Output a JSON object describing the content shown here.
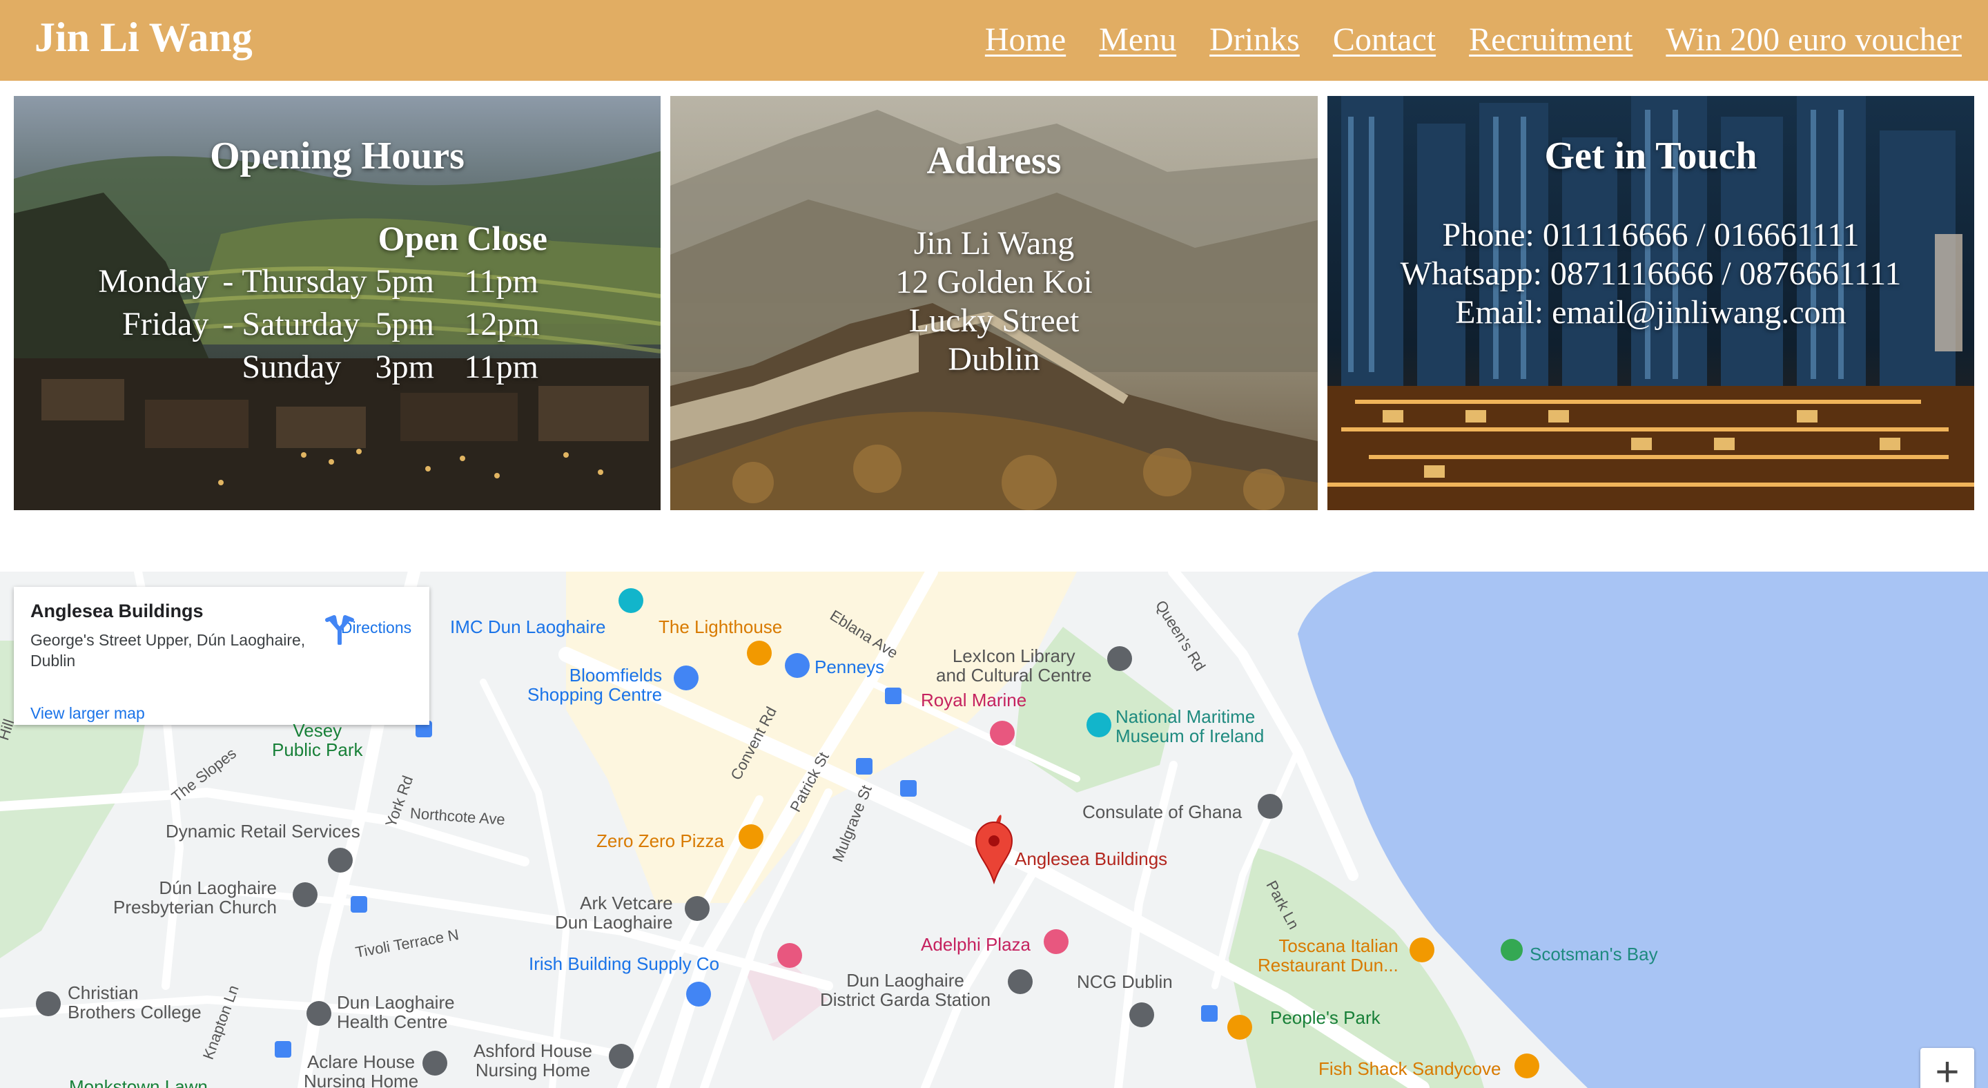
{
  "header": {
    "brand": "Jin Li Wang",
    "nav": [
      "Home",
      "Menu",
      "Drinks",
      "Contact",
      "Recruitment",
      "Win 200 euro voucher"
    ]
  },
  "hours": {
    "title": "Opening Hours",
    "col_open": "Open",
    "col_close": "Close",
    "rows": [
      {
        "from": "Monday",
        "dash": "-",
        "to": "Thursday",
        "open": "5pm",
        "close": "11pm"
      },
      {
        "from": "Friday",
        "dash": "-",
        "to": "Saturday",
        "open": "5pm",
        "close": "12pm"
      },
      {
        "from": "",
        "dash": "",
        "to": "Sunday",
        "open": "3pm",
        "close": "11pm"
      }
    ]
  },
  "address": {
    "title": "Address",
    "lines": [
      "Jin Li Wang",
      "12 Golden Koi",
      "Lucky Street",
      "Dublin"
    ]
  },
  "contact": {
    "title": "Get in Touch",
    "lines": [
      "Phone: 011116666 / 016661111",
      "Whatsapp: 0871116666 / 0876661111",
      "Email: email@jinliwang.com"
    ]
  },
  "map": {
    "card": {
      "title": "Anglesea Buildings",
      "address": "George's Street Upper, Dún Laoghaire, Dublin",
      "larger": "View larger map",
      "directions": "Directions"
    },
    "pois": {
      "imc": "IMC Dun Laoghaire",
      "lighthouse": "The Lighthouse",
      "penneys": "Penneys",
      "bloomfields": "Bloomfields\nShopping Centre",
      "lexicon": "LexIcon Library\nand Cultural Centre",
      "royal_marine": "Royal Marine",
      "maritime": "National Maritime\nMuseum of Ireland",
      "vesey": "Vesey\nPublic Park",
      "consulate": "Consulate of Ghana",
      "dynamic": "Dynamic Retail Services",
      "zero": "Zero Zero Pizza",
      "anglesea": "Anglesea Buildings",
      "presbyterian": "Dún Laoghaire\nPresbyterian Church",
      "ark": "Ark Vetcare\nDun Laoghaire",
      "adelphi": "Adelphi Plaza",
      "toscana": "Toscana Italian\nRestaurant Dun...",
      "scotsmans": "Scotsman's Bay",
      "irish_building": "Irish Building Supply Co",
      "garda": "Dun Laoghaire\nDistrict Garda Station",
      "ncg": "NCG Dublin",
      "peoples": "People's Park",
      "christian": "Christian\nBrothers College",
      "health": "Dun Laoghaire\nHealth Centre",
      "aclare": "Aclare House\nNursing Home",
      "ashford": "Ashford House\nNursing Home",
      "fish": "Fish Shack Sandycove",
      "monkstown": "Monkstown Lawn"
    },
    "streets": {
      "eblana": "Eblana Ave",
      "queens": "Queen's Rd",
      "convent": "Convent Rd",
      "patrick": "Patrick St",
      "mulgrave": "Mulgrave St",
      "slopes": "The Slopes",
      "york": "York Rd",
      "northcote": "Northcote Ave",
      "tivoli": "Tivoli Terrace N",
      "knapton": "Knapton Ln",
      "park": "Park Ln",
      "hill": "Hill"
    },
    "zoom_in": "+"
  }
}
